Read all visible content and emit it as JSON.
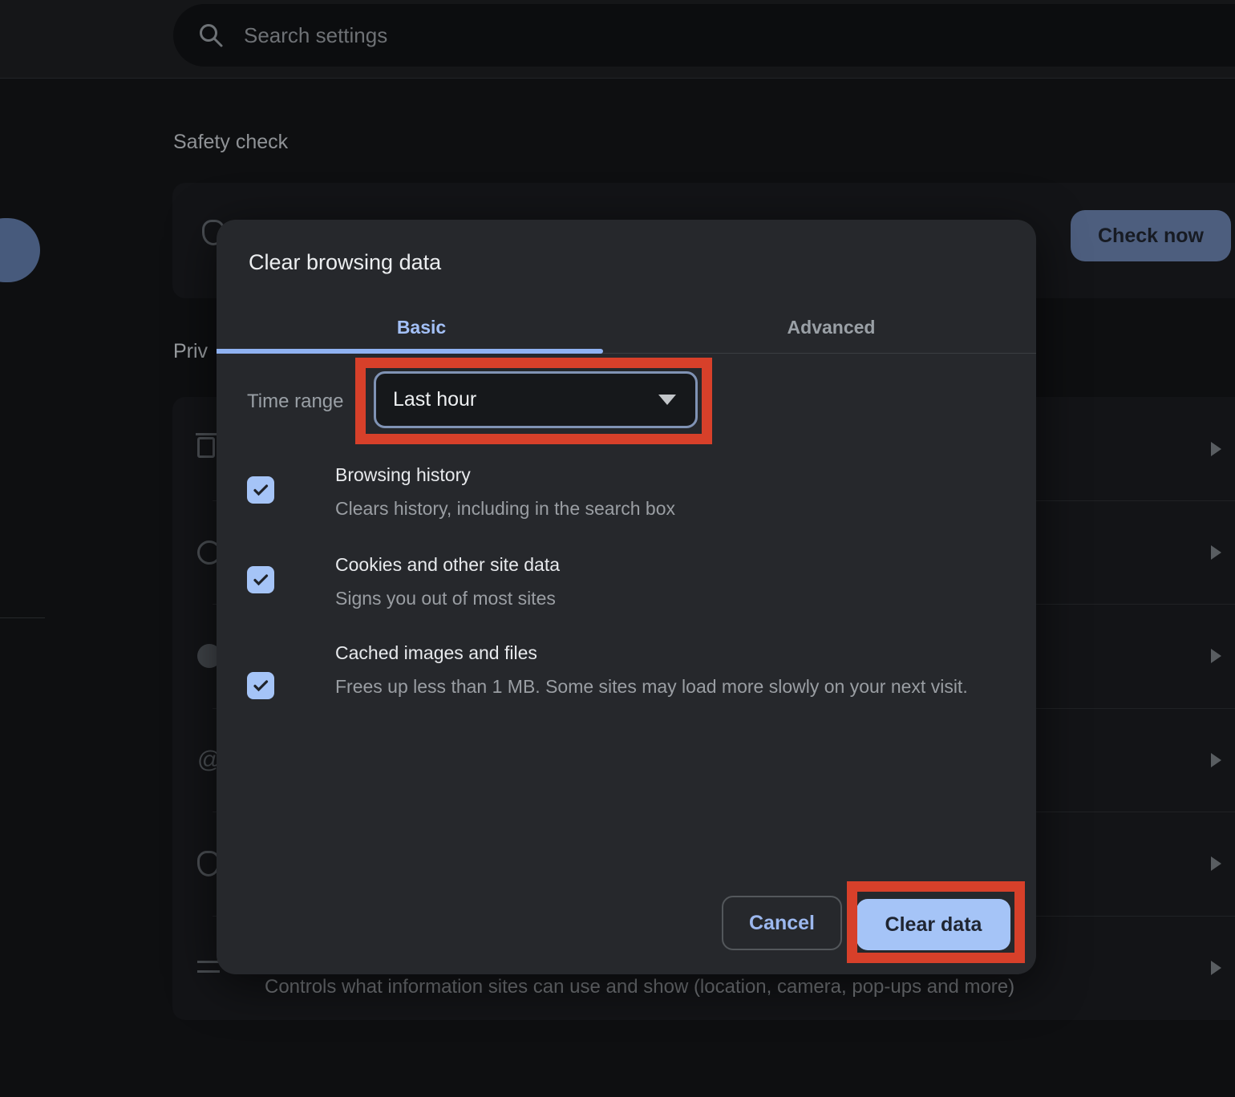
{
  "header": {
    "search_placeholder": "Search settings"
  },
  "page": {
    "safety_check_heading": "Safety check",
    "check_now_label": "Check now",
    "privacy_heading_fragment": "Priv",
    "site_settings_description": "Controls what information sites can use and show (location, camera, pop-ups and more)"
  },
  "dialog": {
    "title": "Clear browsing data",
    "tabs": [
      {
        "label": "Basic",
        "active": true
      },
      {
        "label": "Advanced",
        "active": false
      }
    ],
    "time_range": {
      "label": "Time range",
      "selected_option": "Last hour"
    },
    "options": [
      {
        "title": "Browsing history",
        "description": "Clears history, including in the search box",
        "checked": true
      },
      {
        "title": "Cookies and other site data",
        "description": "Signs you out of most sites",
        "checked": true
      },
      {
        "title": "Cached images and files",
        "description": "Frees up less than 1 MB. Some sites may load more slowly on your next visit.",
        "checked": true
      }
    ],
    "buttons": {
      "cancel": "Cancel",
      "confirm": "Clear data"
    }
  },
  "annotations": {
    "highlight_color": "#d7402a"
  },
  "colors": {
    "accent_blue": "#a5c4f7",
    "tab_active_blue": "#a3c0f7",
    "dialog_background": "#26282c",
    "page_background": "#0e0f11",
    "muted_button_blue": "#4d5e7e"
  }
}
